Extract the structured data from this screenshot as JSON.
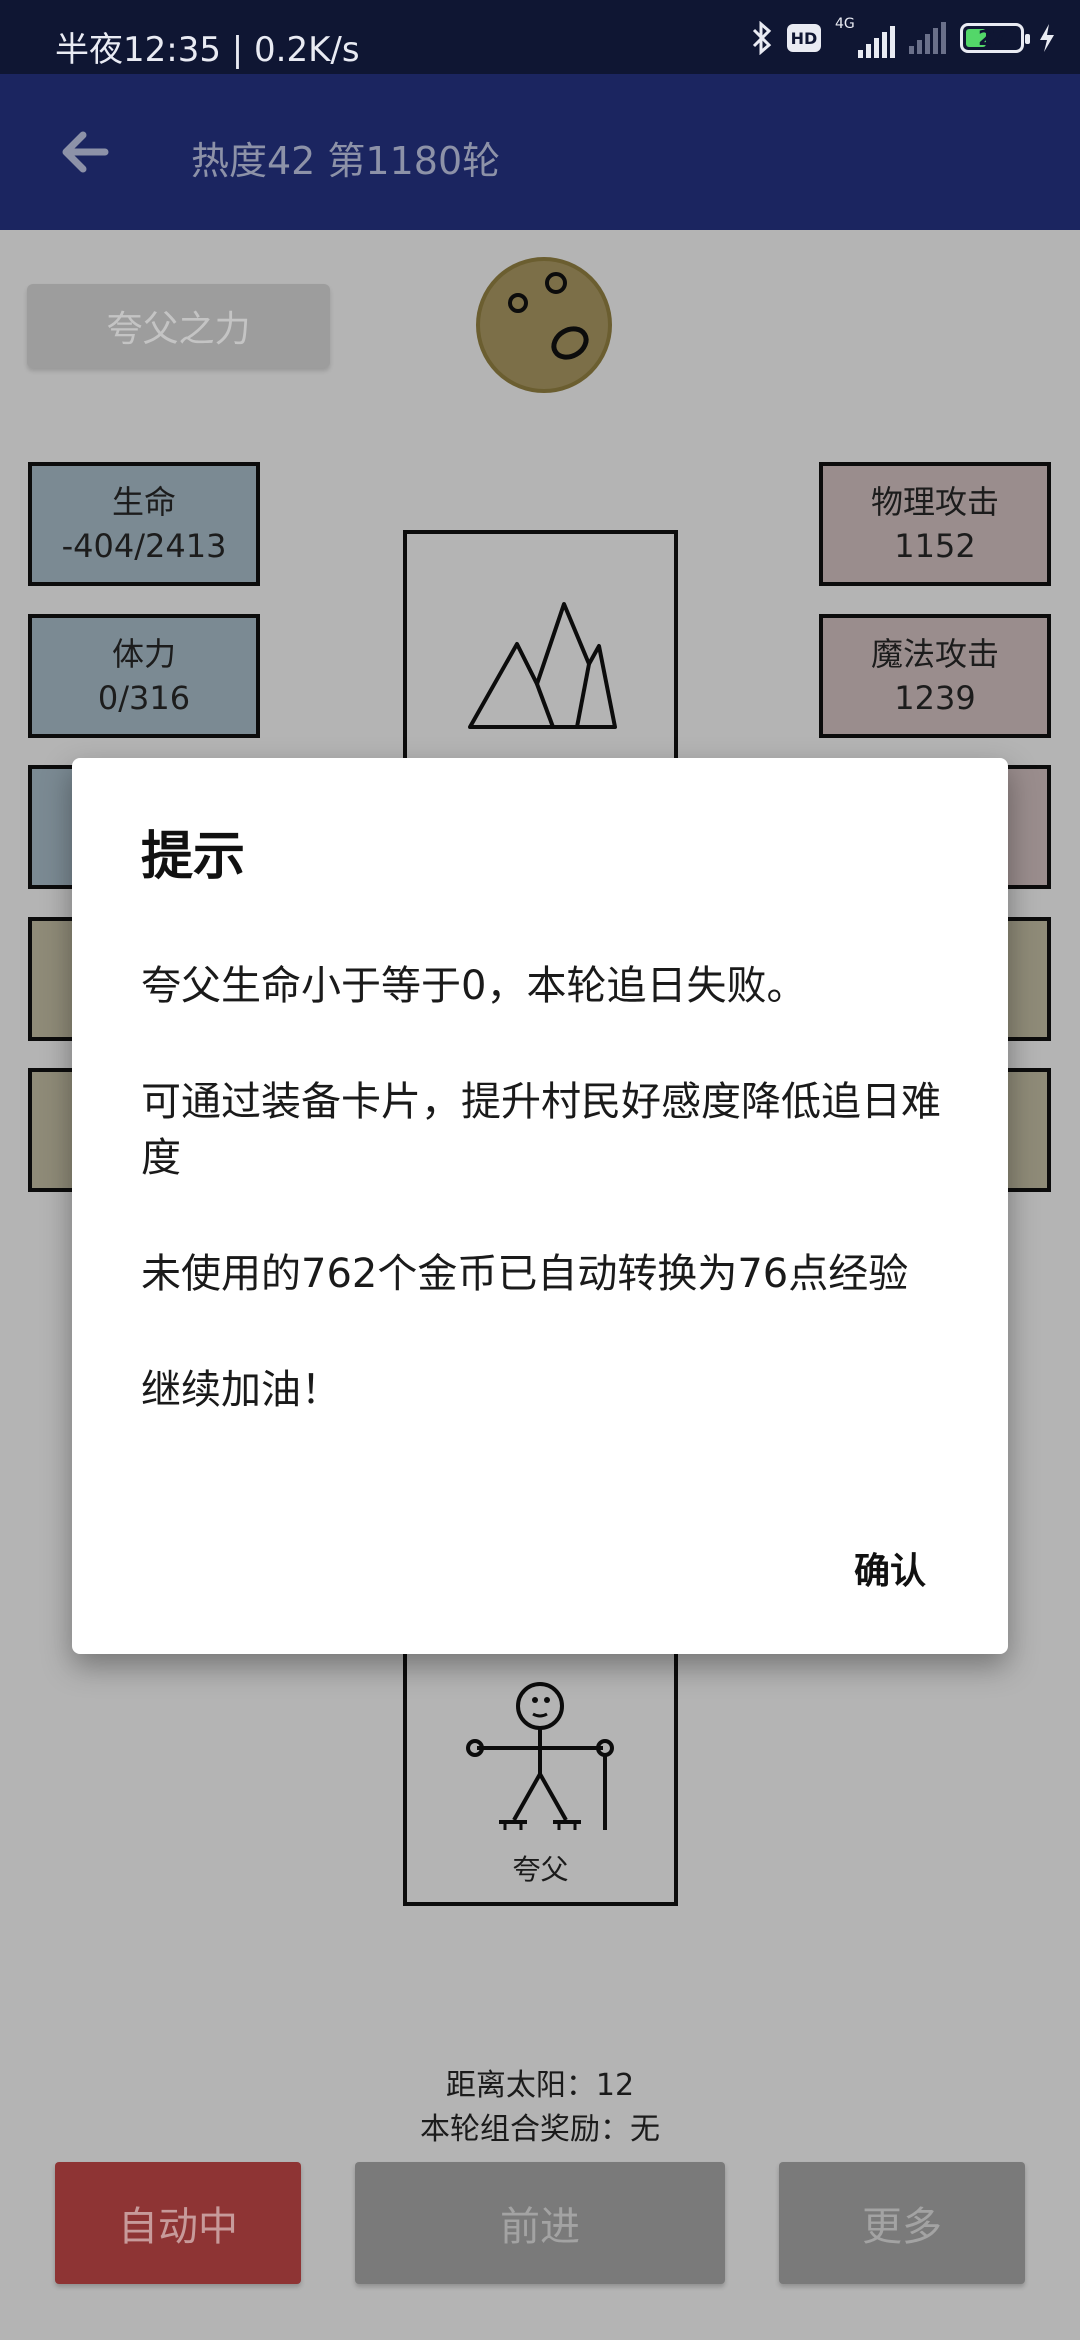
{
  "status_bar": {
    "time_speed": "半夜12:35 | 0.2K/s",
    "network": "4G",
    "hd": "HD",
    "battery": "27"
  },
  "app_bar": {
    "title": "热度42 第1180轮"
  },
  "skill_button": "夸父之力",
  "stats_left": [
    {
      "label": "生命",
      "value": "-404/2413"
    },
    {
      "label": "体力",
      "value": "0/316"
    }
  ],
  "stats_right": [
    {
      "label": "物理攻击",
      "value": "1152"
    },
    {
      "label": "魔法攻击",
      "value": "1239"
    }
  ],
  "hero_card": {
    "name": "夸父"
  },
  "bottom_info": {
    "distance": "距离太阳：12",
    "combo_reward": "本轮组合奖励：无"
  },
  "bottom_buttons": {
    "auto": "自动中",
    "forward": "前进",
    "more": "更多"
  },
  "dialog": {
    "title": "提示",
    "messages": [
      "夸父生命小于等于0，本轮追日失败。",
      "可通过装备卡片，提升村民好感度降低追日难度",
      "未使用的762个金币已自动转换为76点经验",
      "继续加油！"
    ],
    "confirm": "确认"
  },
  "colors": {
    "status_bar": "#0f1633",
    "app_bar": "#1b2560",
    "auto_button": "#8e3434",
    "neutral_button": "#7a7a7a"
  }
}
